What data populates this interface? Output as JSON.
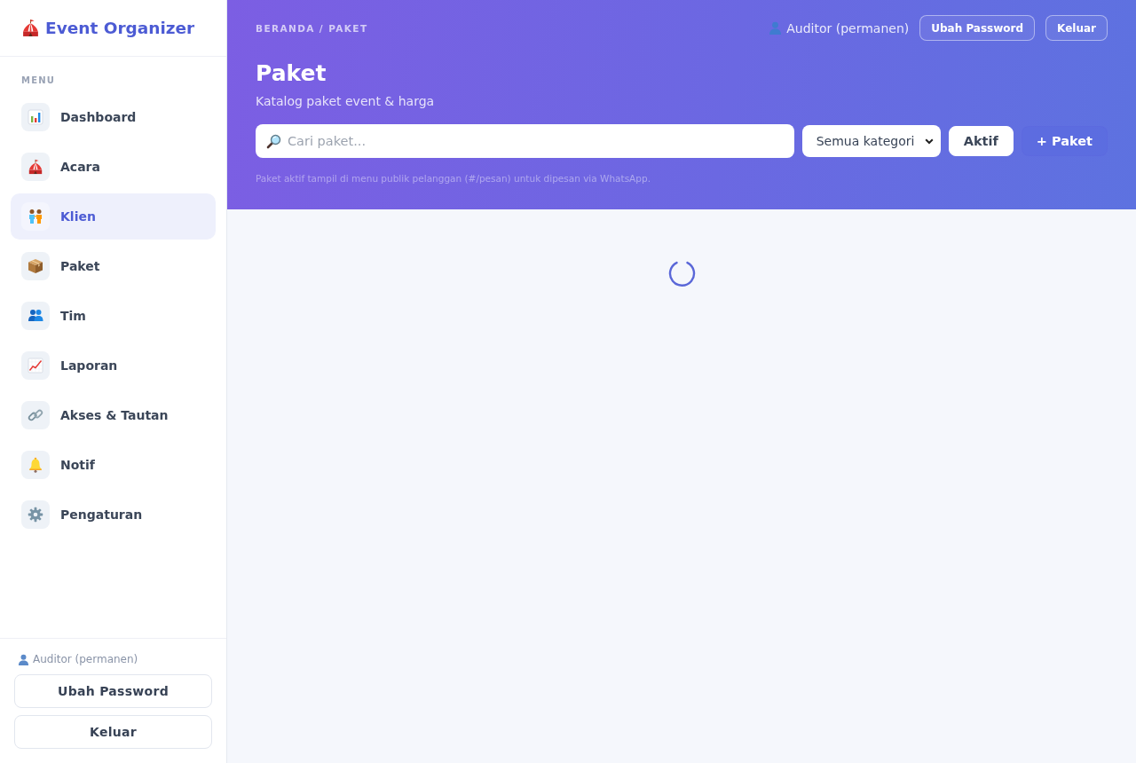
{
  "sidebar": {
    "brand": "Event Organizer",
    "section_label": "MENU",
    "items": [
      {
        "label": "Dashboard",
        "selected": false
      },
      {
        "label": "Acara",
        "selected": false
      },
      {
        "label": "Klien",
        "selected": true
      },
      {
        "label": "Paket",
        "selected": false
      },
      {
        "label": "Tim",
        "selected": false
      },
      {
        "label": "Laporan",
        "selected": false
      },
      {
        "label": "Akses & Tautan",
        "selected": false
      },
      {
        "label": "Notif",
        "selected": false
      },
      {
        "label": "Pengaturan",
        "selected": false
      }
    ],
    "footer": {
      "user": "Auditor (permanen)",
      "buttons": [
        "Ubah Password",
        "Keluar"
      ]
    }
  },
  "header": {
    "breadcrumb": "BERANDA / PAKET",
    "user": "Auditor (permanen)",
    "buttons": [
      "Ubah Password",
      "Keluar"
    ],
    "title": "Paket",
    "subtitle": "Katalog paket event & harga",
    "search": {
      "placeholder": "Cari paket..."
    },
    "category_select": {
      "value": "Semua kategori"
    },
    "actions": [
      {
        "label": "Aktif",
        "kind": "light"
      },
      {
        "label": "+ Paket",
        "kind": "tinted"
      }
    ],
    "note": "Paket aktif tampil di menu publik pelanggan (#/pesan) untuk dipesan via WhatsApp."
  },
  "content": {
    "loading": true
  }
}
